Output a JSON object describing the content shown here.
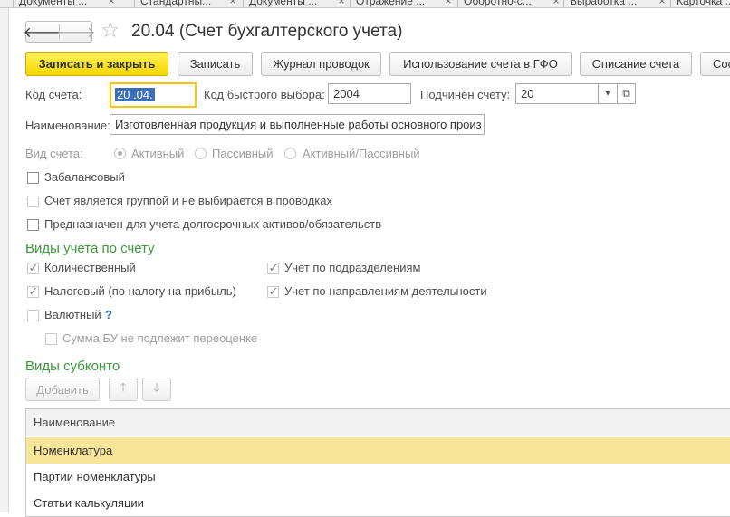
{
  "window_tabs": [
    {
      "label": "Документы ..."
    },
    {
      "label": "Стандартны..."
    },
    {
      "label": "Документы ..."
    },
    {
      "label": "Отражение ..."
    },
    {
      "label": "Оборотно-с..."
    },
    {
      "label": "Выработка ..."
    },
    {
      "label": "Карточка ..."
    }
  ],
  "header": {
    "title": "20.04 (Счет бухгалтерского учета)",
    "back_glyph": "🡐",
    "forward_glyph": "🡒"
  },
  "toolbar": {
    "save_close": "Записать и закрыть",
    "save": "Записать",
    "journal": "Журнал проводок",
    "usage_gfo": "Использование счета в ГФО",
    "description": "Описание счета",
    "more": "Сос"
  },
  "form": {
    "code_label": "Код счета:",
    "code_value": "20 .04.",
    "quick_code_label": "Код быстрого выбора:",
    "quick_code_value": "2004",
    "parent_label": "Подчинен счету:",
    "parent_value": "20",
    "name_label": "Наименование:",
    "name_value": "Изготовленная продукция и выполненные работы основного произ",
    "type_label": "Вид счета:",
    "type_options": [
      "Активный",
      "Пассивный",
      "Активный/Пассивный"
    ],
    "type_selected": "Активный",
    "off_balance": "Забалансовый",
    "is_group": "Счет является группой и не выбирается в проводках",
    "long_term": "Предназначен для учета долгосрочных активов/обязательств"
  },
  "accounting": {
    "section_title": "Виды учета по счету",
    "quantitative": "Количественный",
    "tax": "Налоговый (по налогу на прибыль)",
    "currency": "Валютный",
    "currency_help": "?",
    "no_revaluation": "Сумма БУ не подлежит переоценке",
    "by_department": "Учет по подразделениям",
    "by_activity": "Учет по направлениям деятельности"
  },
  "subconto": {
    "section_title": "Виды субконто",
    "add": "Добавить",
    "up_glyph": "🡑",
    "down_glyph": "🡓",
    "column_name": "Наименование",
    "rows": [
      {
        "name": "Номенклатура"
      },
      {
        "name": "Партии номенклатуры"
      },
      {
        "name": "Статьи калькуляции"
      }
    ]
  },
  "icons": {
    "tab_close": "×",
    "favorite_star": "☆",
    "dropdown": "▾",
    "open": "⧉",
    "check": "✓"
  },
  "colors": {
    "primary_button": "#f5d500",
    "section_title": "#3a9a3a",
    "selected_row": "#f9e59a",
    "focus_border": "#f5c900"
  }
}
